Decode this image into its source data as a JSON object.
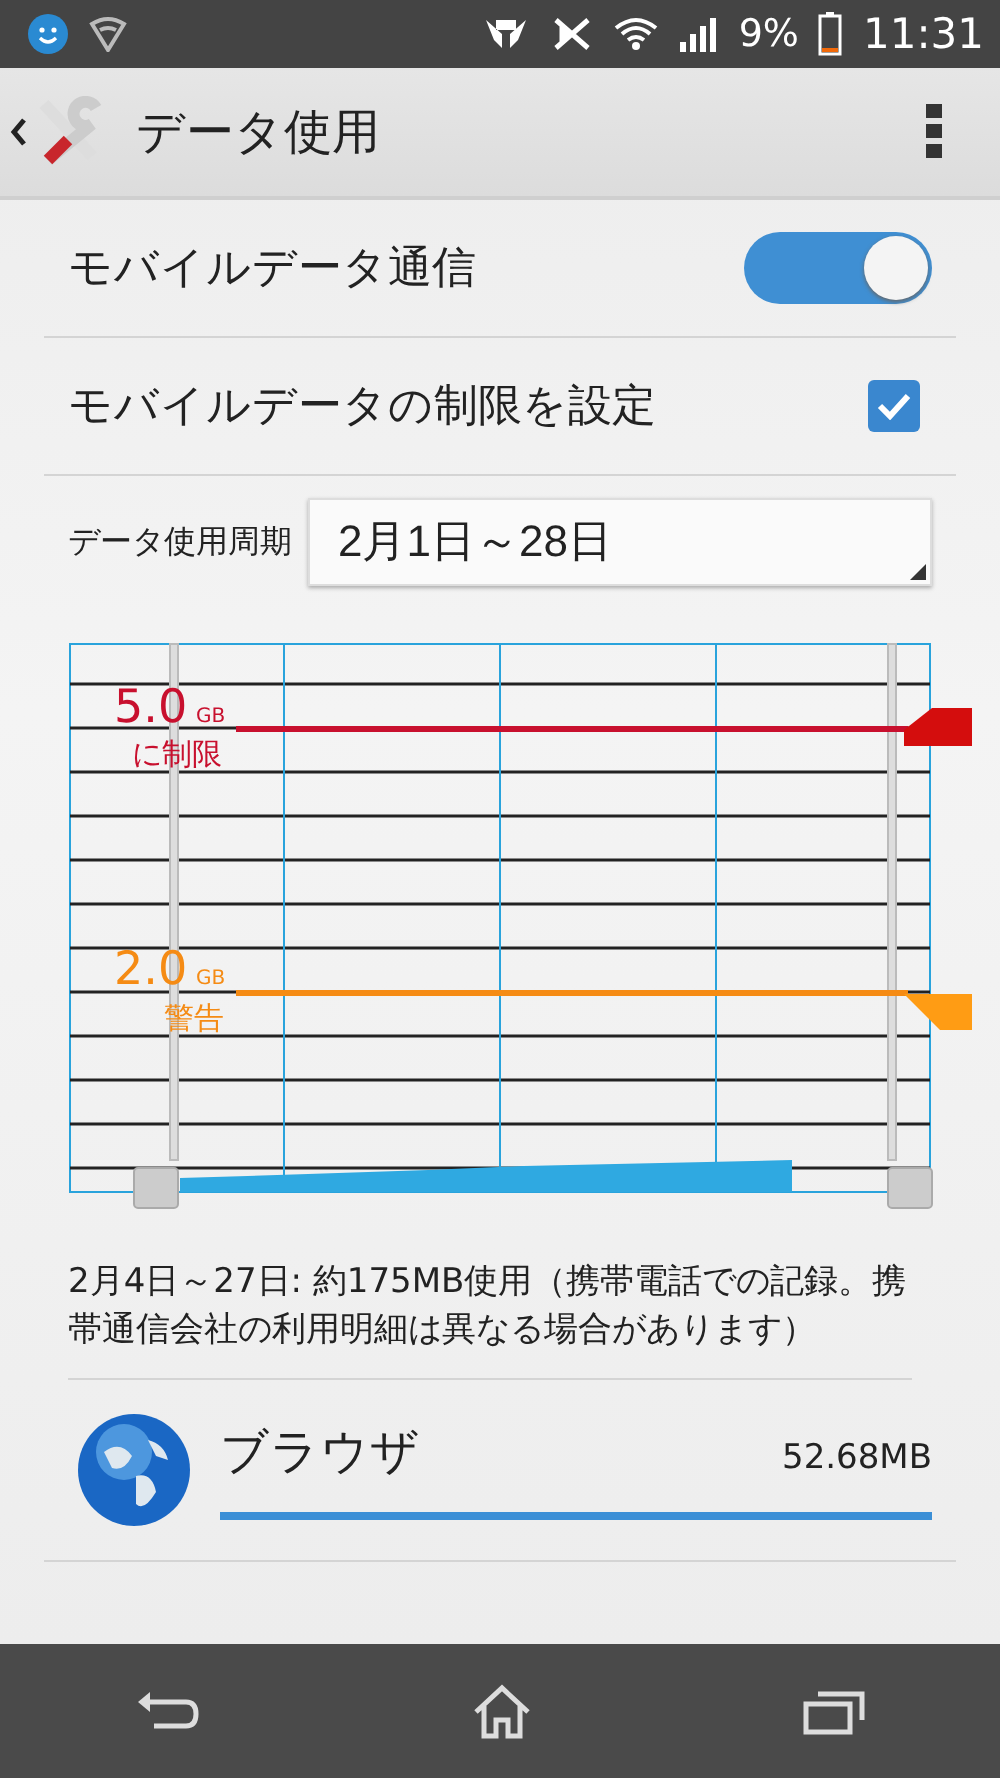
{
  "status_bar": {
    "battery": "9%",
    "time": "11:31"
  },
  "action_bar": {
    "title": "データ使用"
  },
  "settings": [
    {
      "kind": "switch",
      "label": "モバイルデータ通信",
      "on": true
    },
    {
      "kind": "checkbox",
      "label": "モバイルデータの制限を設定",
      "checked": true
    }
  ],
  "cycle": {
    "label": "データ使用周期",
    "value": "2月1日～28日"
  },
  "chart": {
    "limit": {
      "value": "5.0",
      "unit": "GB",
      "caption": "に制限"
    },
    "warning": {
      "value": "2.0",
      "unit": "GB",
      "caption": "警告"
    }
  },
  "summary": "2月4日～27日: 約175MB使用（携帯電話での記録。携帯通信会社の利用明細は異なる場合があります）",
  "apps": [
    {
      "name": "ブラウザ",
      "usage": "52.68MB",
      "level": 1.0
    }
  ]
}
